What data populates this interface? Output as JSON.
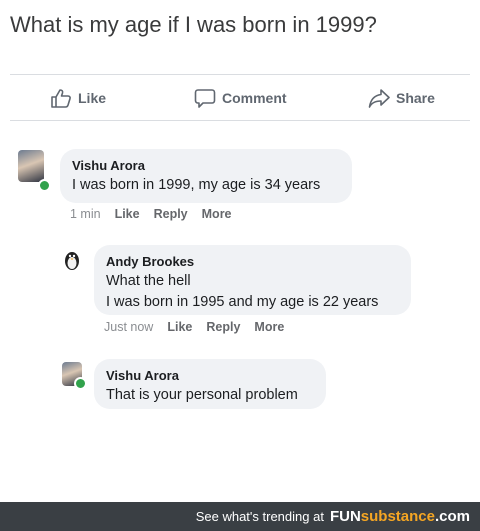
{
  "post": {
    "title": "What is my age if I was born in 1999?"
  },
  "actions": {
    "like": "Like",
    "comment": "Comment",
    "share": "Share"
  },
  "comments": [
    {
      "author": "Vishu Arora",
      "lines": [
        "I was born in 1999, my age is 34 years"
      ],
      "time": "1 min",
      "like": "Like",
      "reply": "Reply",
      "more": "More"
    },
    {
      "author": "Andy Brookes",
      "lines": [
        "What the hell",
        "I was born in 1995 and my age is 22 years"
      ],
      "time": "Just now",
      "like": "Like",
      "reply": "Reply",
      "more": "More"
    },
    {
      "author": "Vishu Arora",
      "lines": [
        "That is your personal problem"
      ]
    }
  ],
  "footer": {
    "text": "See what's trending at",
    "brand_fun": "FUN",
    "brand_sub": "substance",
    "brand_tld": ".com"
  }
}
